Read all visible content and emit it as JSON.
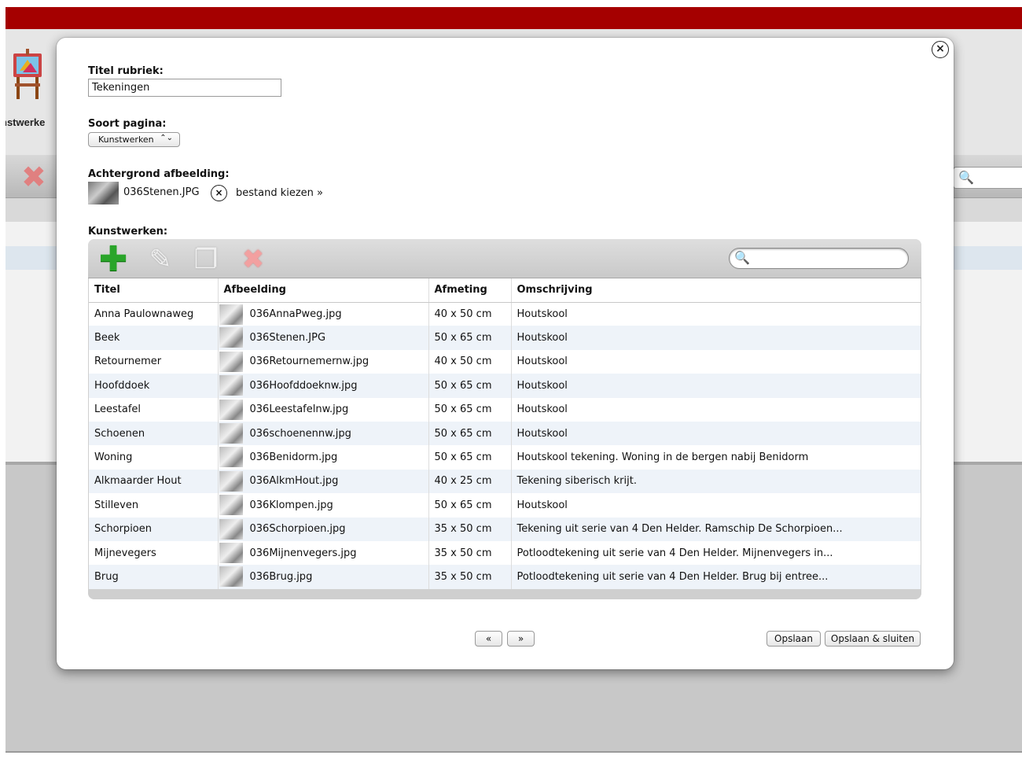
{
  "background": {
    "app_label": "nstwerke",
    "search_glyph": "🔍"
  },
  "modal": {
    "close_glyph": "×",
    "title_label": "Titel rubriek:",
    "title_value": "Tekeningen",
    "type_label": "Soort pagina:",
    "type_value": "Kunstwerken",
    "type_arrows": "⌃⌄",
    "background_label": "Achtergrond afbeelding:",
    "background_file": "036Stenen.JPG",
    "remove_glyph": "×",
    "choose_file": "bestand kiezen »",
    "artworks_label": "Kunstwerken:"
  },
  "toolbar": {
    "add_glyph": "✚",
    "edit_glyph": "✎",
    "copy_glyph": "❐",
    "delete_glyph": "✖",
    "search_glyph": "🔍",
    "search_value": ""
  },
  "table": {
    "columns": [
      "Titel",
      "Afbeelding",
      "Afmeting",
      "Omschrijving"
    ],
    "rows": [
      [
        "Anna Paulownaweg",
        "036AnnaPweg.jpg",
        "40 x 50 cm",
        "Houtskool"
      ],
      [
        "Beek",
        "036Stenen.JPG",
        "50 x 65 cm",
        "Houtskool"
      ],
      [
        "Retournemer",
        "036Retournemernw.jpg",
        "40 x 50 cm",
        "Houtskool"
      ],
      [
        "Hoofddoek",
        "036Hoofddoeknw.jpg",
        "50 x 65 cm",
        "Houtskool"
      ],
      [
        "Leestafel",
        "036Leestafelnw.jpg",
        "50 x 65 cm",
        "Houtskool"
      ],
      [
        "Schoenen",
        "036schoenennw.jpg",
        "50 x 65 cm",
        "Houtskool"
      ],
      [
        "Woning",
        "036Benidorm.jpg",
        "50 x 65 cm",
        "Houtskool tekening. Woning in de bergen nabij Benidorm"
      ],
      [
        "Alkmaarder Hout",
        "036AlkmHout.jpg",
        "40 x 25 cm",
        "Tekening siberisch krijt."
      ],
      [
        "Stilleven",
        "036Klompen.jpg",
        "50 x 65 cm",
        "Houtskool"
      ],
      [
        "Schorpioen",
        "036Schorpioen.jpg",
        "35 x 50 cm",
        "Tekening uit serie van 4 Den Helder. Ramschip De Schorpioen..."
      ],
      [
        "Mijnevegers",
        "036Mijnenvegers.jpg",
        "35 x 50 cm",
        "Potloodtekening uit serie van 4 Den Helder. Mijnenvegers in..."
      ],
      [
        "Brug",
        "036Brug.jpg",
        "35 x 50 cm",
        "Potloodtekening uit serie van 4 Den Helder. Brug bij entree..."
      ]
    ]
  },
  "footer": {
    "prev": "«",
    "next": "»",
    "save": "Opslaan",
    "save_close": "Opslaan & sluiten"
  },
  "colors": {
    "topbar": "#a50000",
    "add_icon": "#2aa52a",
    "row_alt": "#eef3f9"
  }
}
